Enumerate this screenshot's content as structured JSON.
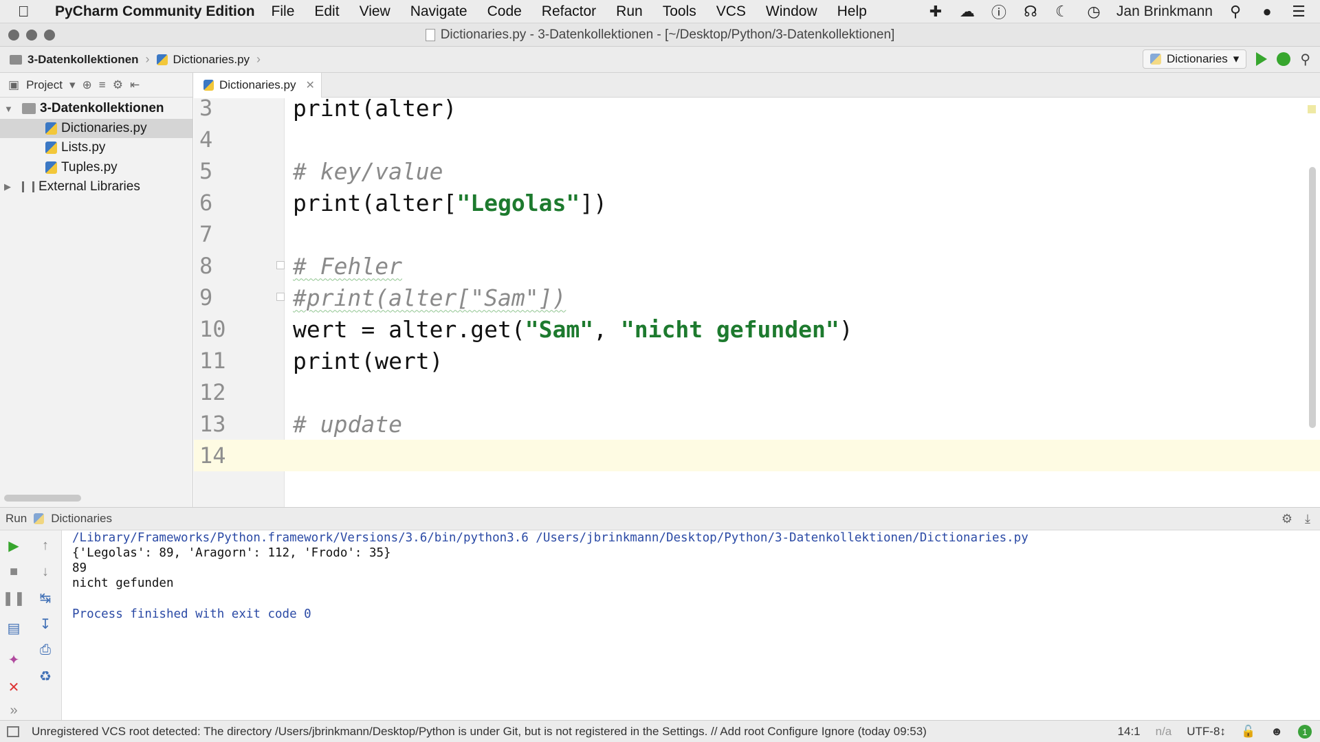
{
  "menubar": {
    "app_name": "PyCharm Community Edition",
    "items": [
      "File",
      "Edit",
      "View",
      "Navigate",
      "Code",
      "Refactor",
      "Run",
      "Tools",
      "VCS",
      "Window",
      "Help"
    ],
    "user": "Jan Brinkmann"
  },
  "window": {
    "title": "Dictionaries.py - 3-Datenkollektionen - [~/Desktop/Python/3-Datenkollektionen]"
  },
  "navbar": {
    "crumb_project": "3-Datenkollektionen",
    "crumb_file": "Dictionaries.py",
    "run_config": "Dictionaries"
  },
  "project_panel": {
    "label": "Project",
    "root": "3-Datenkollektionen",
    "files": [
      "Dictionaries.py",
      "Lists.py",
      "Tuples.py"
    ],
    "external": "External Libraries"
  },
  "editor": {
    "tab": "Dictionaries.py",
    "lines": [
      {
        "num": "3",
        "code": "print(alter)"
      },
      {
        "num": "4",
        "code": ""
      },
      {
        "num": "5",
        "code": "# key/value"
      },
      {
        "num": "6",
        "code": "print(alter[\"Legolas\"])"
      },
      {
        "num": "7",
        "code": ""
      },
      {
        "num": "8",
        "code": "# Fehler"
      },
      {
        "num": "9",
        "code": "#print(alter[\"Sam\"])"
      },
      {
        "num": "10",
        "code": "wert = alter.get(\"Sam\", \"nicht gefunden\")"
      },
      {
        "num": "11",
        "code": "print(wert)"
      },
      {
        "num": "12",
        "code": ""
      },
      {
        "num": "13",
        "code": "# update"
      },
      {
        "num": "14",
        "code": ""
      }
    ]
  },
  "run_panel": {
    "label": "Run",
    "config": "Dictionaries",
    "output": [
      "/Library/Frameworks/Python.framework/Versions/3.6/bin/python3.6 /Users/jbrinkmann/Desktop/Python/3-Datenkollektionen/Dictionaries.py",
      "{'Legolas': 89, 'Aragorn': 112, 'Frodo': 35}",
      "89",
      "nicht gefunden",
      "",
      "Process finished with exit code 0"
    ]
  },
  "statusbar": {
    "message": "Unregistered VCS root detected: The directory /Users/jbrinkmann/Desktop/Python is under Git, but is not registered in the Settings. // Add root  Configure  Ignore (today 09:53)",
    "position": "14:1",
    "na": "n/a",
    "encoding": "UTF-8↕",
    "badge": "1"
  },
  "colors": {
    "string": "#1d7a2e",
    "comment": "#8a8a8a",
    "current_line": "#fefbe3",
    "run_green": "#37a62e"
  }
}
